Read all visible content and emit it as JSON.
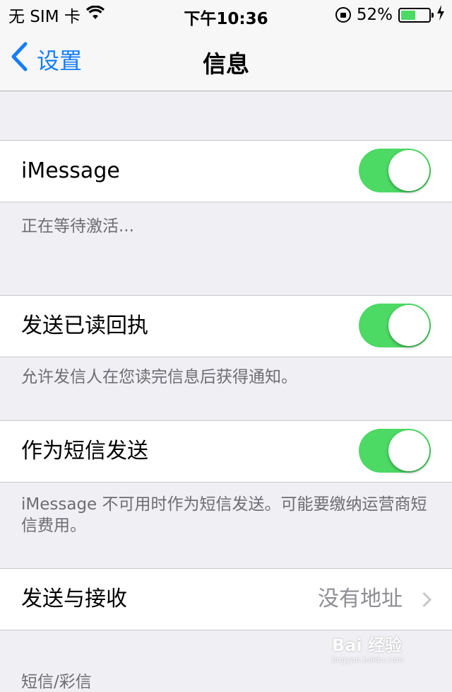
{
  "status_bar": {
    "carrier": "无 SIM 卡",
    "time": "下午10:36",
    "battery_percent": "52%",
    "battery_level": 0.52,
    "battery_color": "#4cd964"
  },
  "nav": {
    "back_label": "设置",
    "title": "信息",
    "accent_color": "#157efb"
  },
  "settings": {
    "imessage": {
      "label": "iMessage",
      "enabled": true,
      "footnote": "正在等待激活..."
    },
    "read_receipts": {
      "label": "发送已读回执",
      "enabled": true,
      "footnote": "允许发信人在您读完信息后获得通知。"
    },
    "send_as_sms": {
      "label": "作为短信发送",
      "enabled": true,
      "footnote": "iMessage 不可用时作为短信发送。可能要缴纳运营商短信费用。"
    },
    "send_receive": {
      "label": "发送与接收",
      "value": "没有地址"
    },
    "next_section_header": "短信/彩信"
  },
  "watermark": {
    "main": "Bai 经验",
    "sub": "jingyan.baidu.com"
  },
  "icons": {
    "back": "chevron-left-icon",
    "wifi": "wifi-icon",
    "orientation_lock": "orientation-lock-icon",
    "battery": "battery-icon",
    "charging": "bolt-icon",
    "disclosure": "chevron-right-icon"
  }
}
